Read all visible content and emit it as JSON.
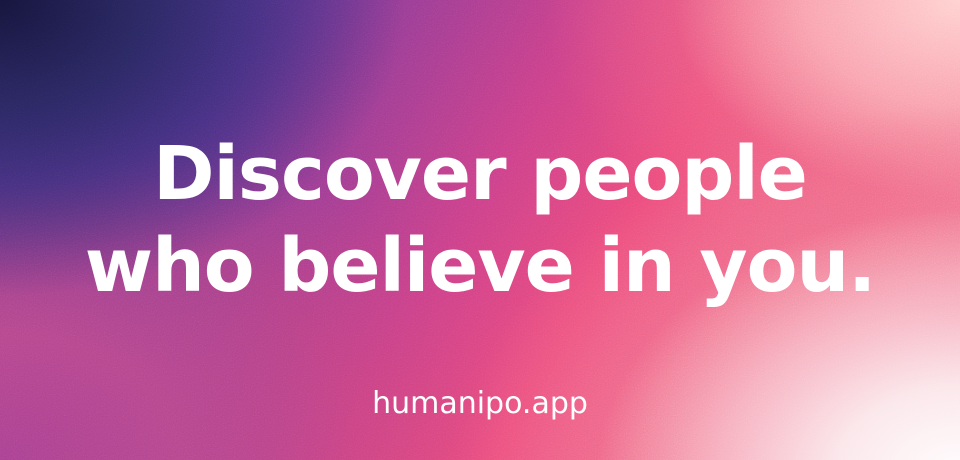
{
  "banner": {
    "headline_line1": "Discover people",
    "headline_line2": "who believe in you.",
    "url": "humanipo.app"
  },
  "colors": {
    "text": "#ffffff",
    "corner_top_left": "#15143a",
    "center": "#e8457a",
    "corner_bottom_right": "#ffffff"
  }
}
